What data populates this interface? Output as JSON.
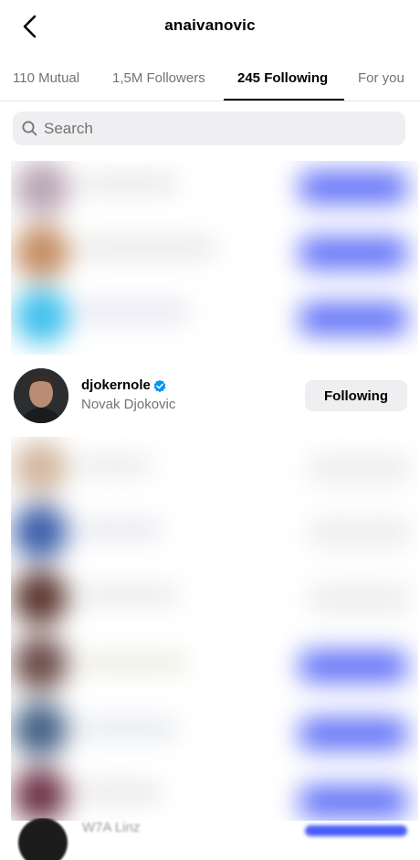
{
  "header": {
    "title": "anaivanovic",
    "back_icon": "chevron-left-icon"
  },
  "tabs": [
    {
      "label": "110 Mutual",
      "active": false
    },
    {
      "label": "1,5M Followers",
      "active": false
    },
    {
      "label": "245 Following",
      "active": true
    },
    {
      "label": "For you",
      "active": false
    }
  ],
  "search": {
    "placeholder": "Search",
    "value": "",
    "icon": "search-icon"
  },
  "following_list": [
    {
      "username": "djokernole",
      "full_name": "Novak Djokovic",
      "verified": true,
      "button_label": "Following"
    }
  ],
  "bottom_partial_text": "W7A Linz",
  "colors": {
    "accent_blue": "#4a5df9",
    "verified_blue": "#0095f6",
    "button_gray": "#efeff1",
    "secondary_text": "#737373"
  }
}
